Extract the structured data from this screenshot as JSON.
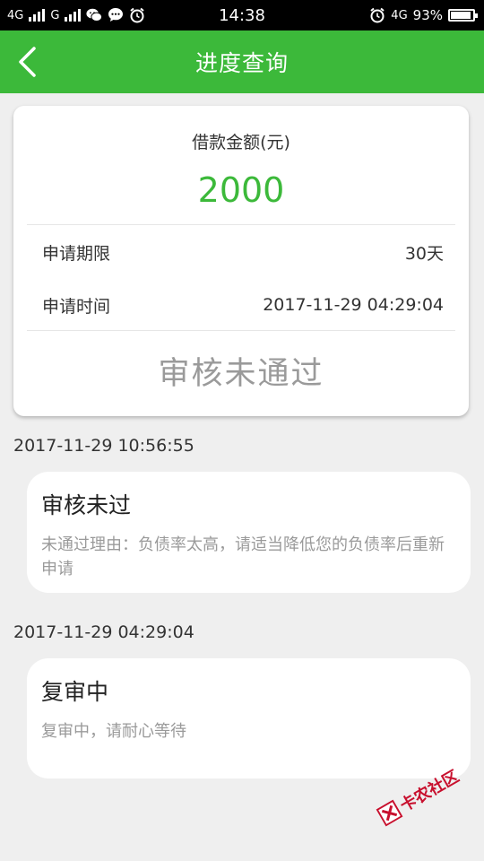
{
  "status_bar": {
    "network_left": "4G",
    "network_left2": "G",
    "time": "14:38",
    "network_right": "4G",
    "battery": "93%",
    "battery_level": 0.93
  },
  "header": {
    "title": "进度查询"
  },
  "summary": {
    "amount_label": "借款金额(元)",
    "amount_value": "2000",
    "rows": [
      {
        "label": "申请期限",
        "value": "30天"
      },
      {
        "label": "申请时间",
        "value": "2017-11-29 04:29:04"
      }
    ],
    "status": "审核未通过"
  },
  "timeline": [
    {
      "timestamp": "2017-11-29 10:56:55",
      "title": "审核未过",
      "desc": "未通过理由：负债率太高，请适当降低您的负债率后重新申请"
    },
    {
      "timestamp": "2017-11-29 04:29:04",
      "title": "复审中",
      "desc": "复审中，请耐心等待"
    }
  ],
  "watermark": {
    "text": "卡农社区"
  },
  "colors": {
    "brand_green": "#3cb93a",
    "status_gray": "#9a9a9a",
    "watermark_red": "#c8102e"
  },
  "icons": {
    "back": "chevron-left-icon",
    "wechat": "wechat-icon",
    "message": "message-icon",
    "alarm": "alarm-icon"
  }
}
